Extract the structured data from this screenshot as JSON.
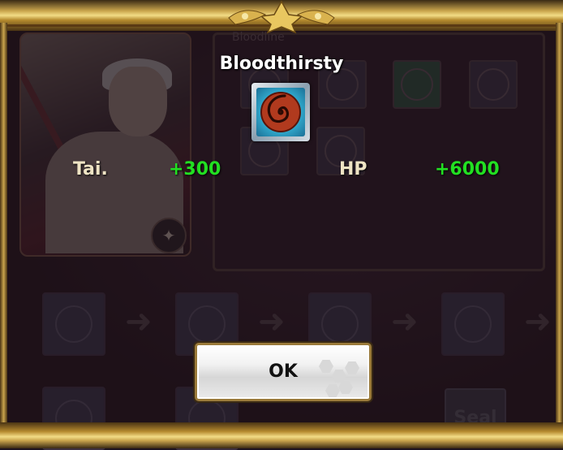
{
  "background": {
    "bloodline_heading": "Bloodline",
    "seal_label": "Seal"
  },
  "popup": {
    "title": "Bloodthirsty",
    "skill_icon": "spiral-swirl-icon",
    "stats": [
      {
        "label": "Tai.",
        "value": "+300"
      },
      {
        "label": "HP",
        "value": "+6000"
      }
    ],
    "ok_button_label": "OK"
  },
  "colors": {
    "stat_value": "#22e022",
    "stat_label": "#efe4c4",
    "frame_gold": "#c9a44c"
  }
}
